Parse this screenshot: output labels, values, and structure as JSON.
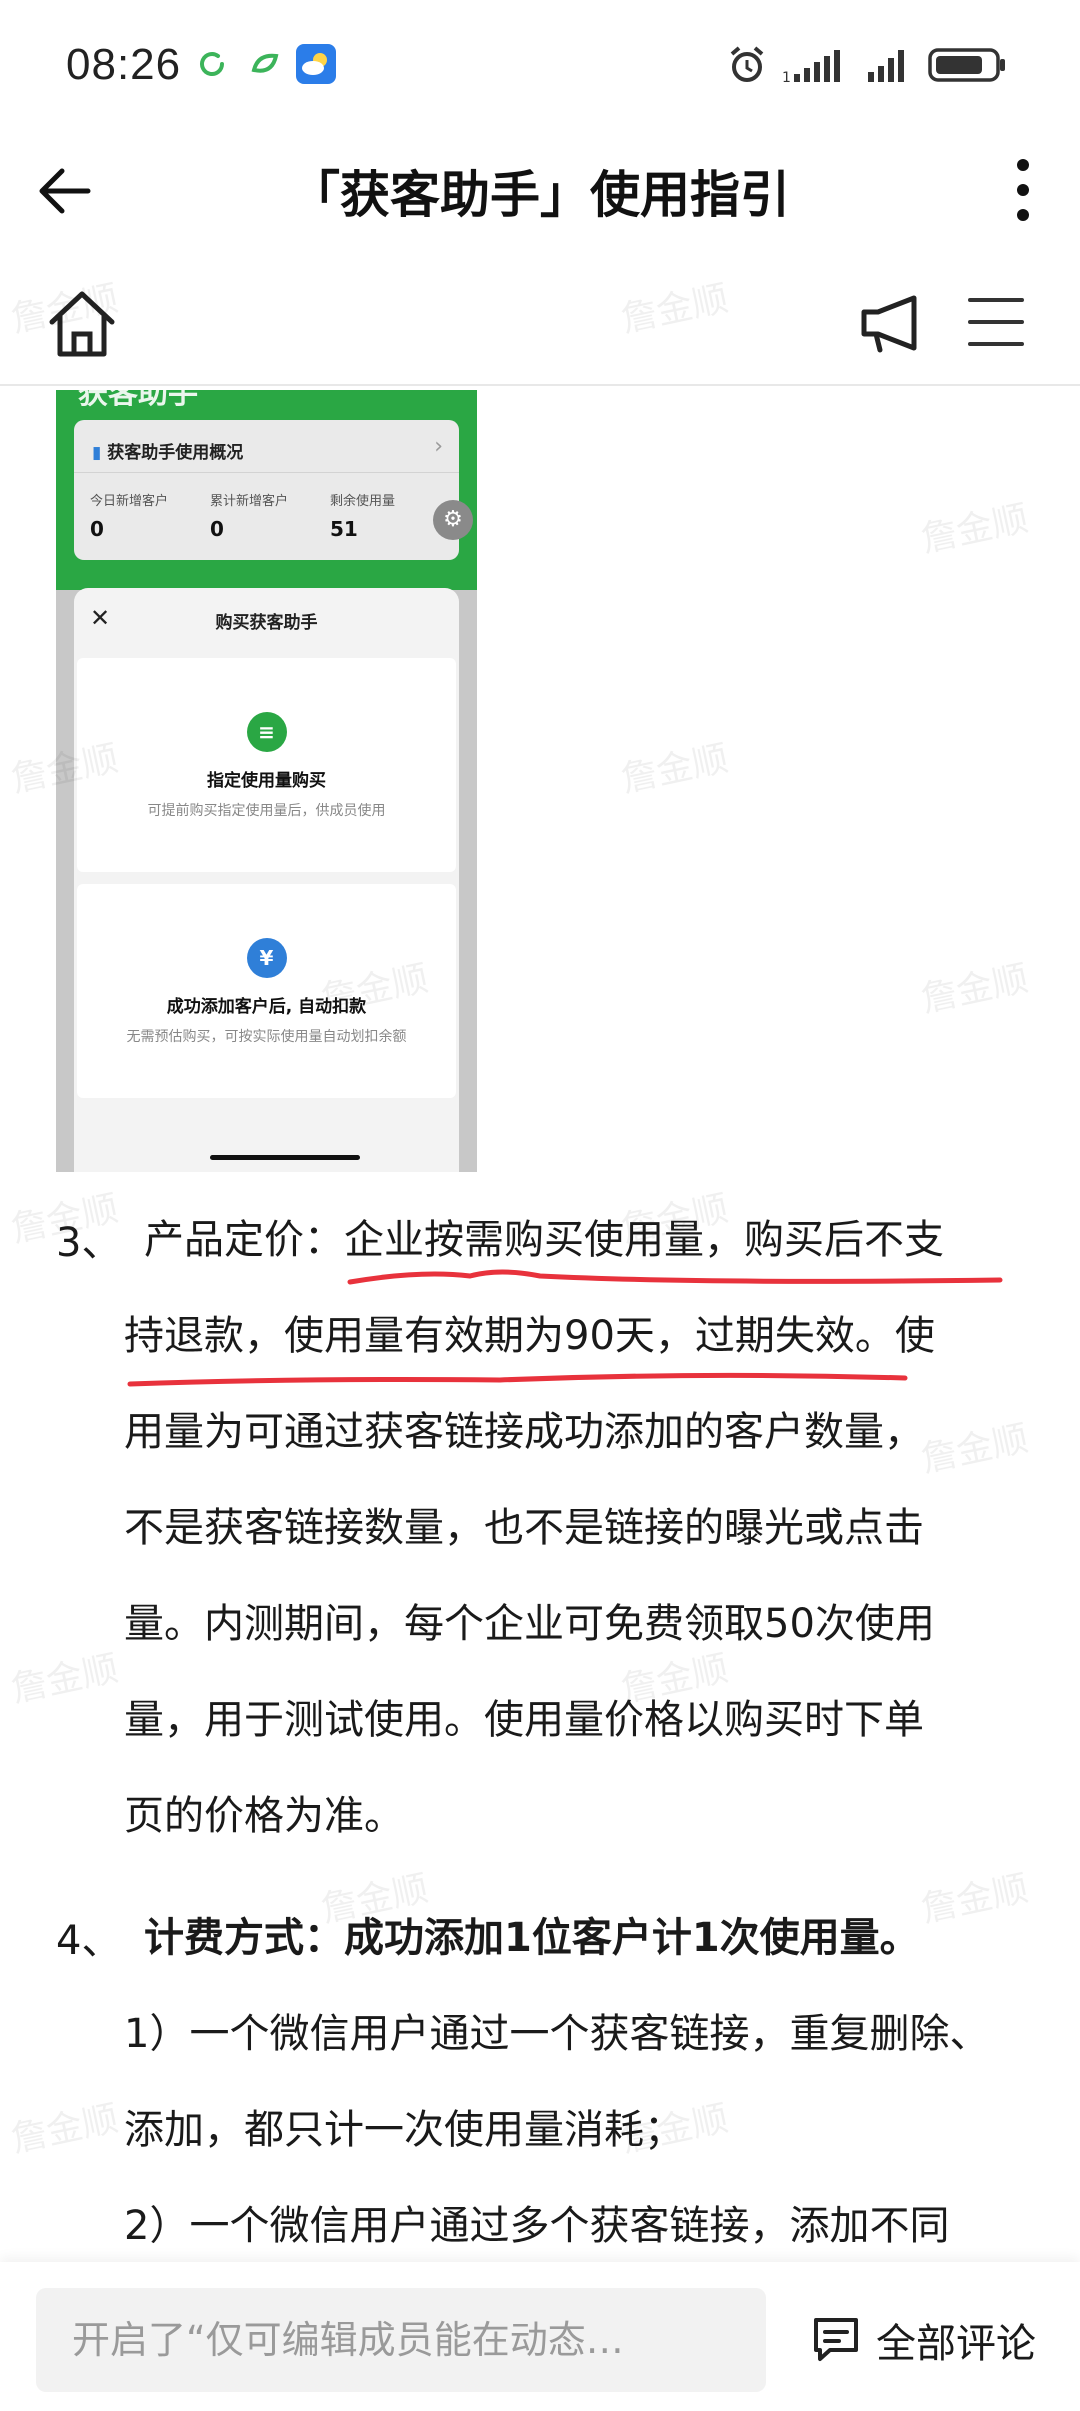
{
  "status_bar": {
    "time": "08:26"
  },
  "title_bar": {
    "title": "「获客助手」使用指引"
  },
  "embedded_screenshot": {
    "header_title": "获客助手",
    "overview_title": "获客助手使用概况",
    "stats": [
      {
        "label": "今日新增客户",
        "value": "0"
      },
      {
        "label": "累计新增客户",
        "value": "0"
      },
      {
        "label": "剩余使用量",
        "value": "51"
      }
    ],
    "sheet_title": "购买获客助手",
    "options": [
      {
        "title": "指定使用量购买",
        "desc": "可提前购买指定使用量后，供成员使用",
        "color": "#2aa744"
      },
      {
        "title": "成功添加客户后, 自动扣款",
        "desc": "无需预估购买，可按实际使用量自动划扣余额",
        "color": "#2f7fd8"
      }
    ]
  },
  "article": {
    "item3_num": "3、",
    "item3_lines": [
      "产品定价：企业按需购买使用量，购买后不支",
      "持退款，使用量有效期为90天，过期失效。使",
      "用量为可通过获客链接成功添加的客户数量，",
      "不是获客链接数量，也不是链接的曝光或点击",
      "量。内测期间，每个企业可免费领取50次使用",
      "量，用于测试使用。使用量价格以购买时下单",
      "页的价格为准。"
    ],
    "item4_num": "4、",
    "item4_title": "计费方式：成功添加1位客户计1次使用量。",
    "item4_lines": [
      "1）一个微信用户通过一个获客链接，重复删除、",
      "添加，都只计一次使用量消耗；",
      "2）一个微信用户通过多个获客链接，添加不同"
    ]
  },
  "watermark": "詹金顺",
  "bottom_bar": {
    "comment_placeholder": "开启了“仅可编辑成员能在动态…",
    "all_comments_label": "全部评论"
  },
  "colors": {
    "underline": "#e8323c",
    "green": "#2aa744"
  }
}
